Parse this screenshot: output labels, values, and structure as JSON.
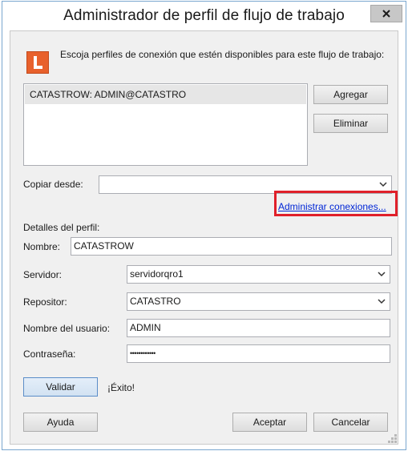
{
  "window": {
    "title": "Administrador de perfil de flujo de trabajo",
    "close_glyph": "x"
  },
  "header": {
    "icon": "orange-l-app-icon",
    "instruction": "Escoja perfiles de conexión que estén disponibles para este flujo de trabajo:"
  },
  "profiles_list": {
    "items": [
      "CATASTROW: ADMIN@CATASTRO"
    ]
  },
  "buttons": {
    "add": "Agregar",
    "remove": "Eliminar",
    "validate": "Validar",
    "help": "Ayuda",
    "accept": "Aceptar",
    "cancel": "Cancelar"
  },
  "copy_from": {
    "label": "Copiar desde:",
    "value": ""
  },
  "manage_link": "Administrar conexiones...",
  "details": {
    "section_label": "Detalles del perfil:",
    "name_label": "Nombre:",
    "name_value": "CATASTROW",
    "server_label": "Servidor:",
    "server_value": "servidorqro1",
    "repository_label": "Repositor:",
    "repository_value": "CATASTRO",
    "username_label": "Nombre del usuario:",
    "username_value": "ADMIN",
    "password_label": "Contraseña:",
    "password_value": "••••••••••••"
  },
  "status": {
    "validation_result": "¡Éxito!"
  },
  "colors": {
    "highlight_border": "#e0202a",
    "link": "#0026d6",
    "app_icon": "#e8612c",
    "window_border": "#7aa7cf"
  }
}
